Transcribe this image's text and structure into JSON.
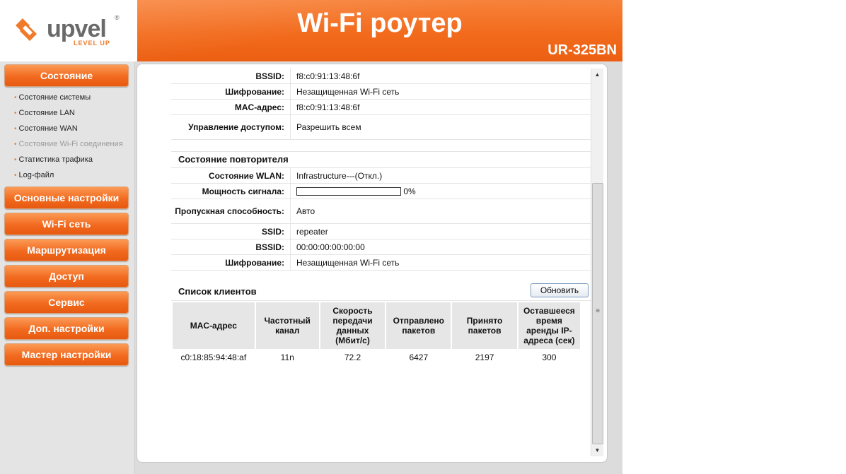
{
  "header": {
    "logo_text": "upvel",
    "logo_reg": "®",
    "logo_tagline": "LEVEL UP",
    "title": "Wi-Fi роутер",
    "model": "UR-325BN",
    "brand_color": "#f26b1d"
  },
  "sidebar": {
    "status_button": "Состояние",
    "sub_items": [
      {
        "label": "Состояние системы",
        "disabled": false
      },
      {
        "label": "Состояние LAN",
        "disabled": false
      },
      {
        "label": "Состояние WAN",
        "disabled": false
      },
      {
        "label": "Состояние Wi-Fi соединения",
        "disabled": true
      },
      {
        "label": "Статистика трафика",
        "disabled": false
      },
      {
        "label": "Log-файл",
        "disabled": false
      }
    ],
    "buttons": [
      "Основные настройки",
      "Wi-Fi сеть",
      "Маршрутизация",
      "Доступ",
      "Сервис",
      "Доп. настройки",
      "Мастер настройки"
    ]
  },
  "ap_info": [
    {
      "label": "BSSID:",
      "value": "f8:c0:91:13:48:6f"
    },
    {
      "label": "Шифрование:",
      "value": "Незащищенная Wi-Fi сеть"
    },
    {
      "label": "MAC-адрес:",
      "value": "f8:c0:91:13:48:6f"
    },
    {
      "label": "Управление доступом:",
      "value": "Разрешить всем"
    }
  ],
  "repeater": {
    "title": "Состояние повторителя",
    "wlan_label": "Состояние WLAN:",
    "wlan_value": "Infrastructure---(Откл.)",
    "signal_label": "Мощность сигнала:",
    "signal_percent": 0,
    "signal_text": "0%",
    "bandwidth_label": "Пропускная способность:",
    "bandwidth_value": "Авто",
    "ssid_label": "SSID:",
    "ssid_value": "repeater",
    "bssid_label": "BSSID:",
    "bssid_value": "00:00:00:00:00:00",
    "encryption_label": "Шифрование:",
    "encryption_value": "Незащищенная Wi-Fi сеть"
  },
  "clients": {
    "title": "Список клиентов",
    "refresh_button": "Обновить",
    "columns": [
      "MAC-адрес",
      "Частотный канал",
      "Скорость передачи данных (Мбит/с)",
      "Отправлено пакетов",
      "Принято пакетов",
      "Оставшееся время аренды IP-адреса (сек)"
    ],
    "rows": [
      [
        "c0:18:85:94:48:af",
        "11n",
        "72.2",
        "6427",
        "2197",
        "300"
      ]
    ]
  }
}
